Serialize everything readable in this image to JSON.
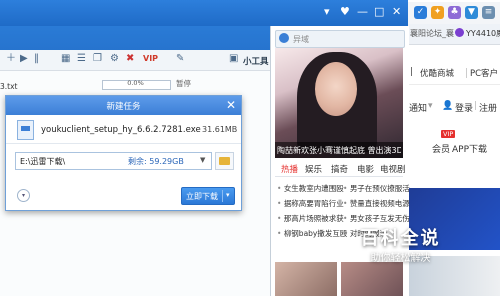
{
  "browser": {
    "tab_primary": "襄阳论坛_襄",
    "tab_secondary": "YY4410魔",
    "nav_items": [
      "优酷商城",
      "PC客户"
    ],
    "nav_first": "|",
    "notice": "通知",
    "login": "登录",
    "register": "注册",
    "vip_badge": "VIP",
    "mini_links": [
      "会员",
      "APP下载"
    ],
    "colors": {
      "shield": "#2b7dd9",
      "brand_purple": "#7b3fd0",
      "search_icon": "#f0a020"
    }
  },
  "xunlei": {
    "title_controls": [
      "▾",
      "♥",
      "—",
      "□",
      "✕"
    ],
    "tool_label": "小工具",
    "task_progress": "0.0%",
    "task_status": "暂停",
    "file_fragment": "3.txt",
    "accent": "#1f6bc7"
  },
  "dialog": {
    "title": "新建任务",
    "close": "✕",
    "file_name": "youkuclient_setup_hy_6.6.2.7281.exe",
    "file_size": "31.61MB",
    "save_path": "E:\\迅雷下载\\",
    "free_space": "剩余: 59.29GB",
    "download_button": "立即下载",
    "button_arrow": "▾",
    "expand": "▾"
  },
  "panel": {
    "search_placeholder": "异域",
    "photo_caption": "陶喆新欢张小骞谨慎起底 曾出演3D肉蒲团",
    "tabs": [
      "热播",
      "娱乐",
      "搞奇",
      "电影",
      "电视剧"
    ],
    "news_left": [
      "女生教室内遭围殴",
      "据称高要胃陷行业",
      "那高片场照被求获",
      "柳钢baby撒发互殴"
    ],
    "news_right": [
      "男子在预仪撩服活",
      "赞量直接视频电源",
      "男女孩子互发无伤",
      "对时的报道"
    ]
  },
  "watermark": {
    "title": "百科全说",
    "subtitle": "助你轻松解决"
  }
}
